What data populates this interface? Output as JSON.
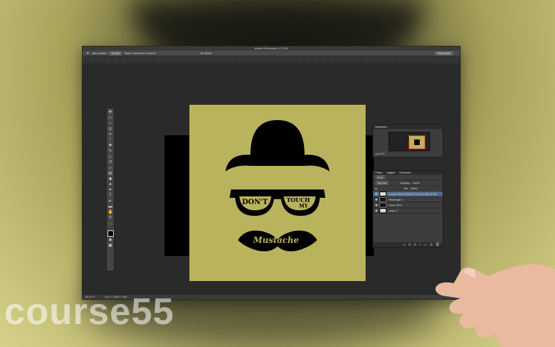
{
  "window": {
    "title": "Adobe Photoshop CC 2015",
    "options_bar": {
      "auto_select_label": "Auto-Select:",
      "auto_select_value": "Group",
      "transform_label": "Show Transform Controls",
      "mode_label": "3D Mode:",
      "workspace_value": "Essentials"
    },
    "status": {
      "zoom": "66.67%",
      "doc": "Doc: 2.06M/7.43M"
    }
  },
  "canvas": {
    "background_color": "#b9b35d",
    "artwork_text": {
      "left_lens": "DON'T",
      "right_lens_line1": "TOUCH",
      "right_lens_line2": "MY",
      "mustache": "Mustache"
    }
  },
  "navigator": {
    "title": "Navigator",
    "zoom": "66.67%"
  },
  "layers_panel": {
    "tabs": [
      "Paths",
      "Layers",
      "Channels"
    ],
    "filter": "Kind",
    "blend_mode": "Normal",
    "opacity_label": "Opacity:",
    "opacity_value": "100%",
    "fill_label": "Fill:",
    "fill_value": "100%",
    "layers": [
      {
        "name": "Screen Shot 2016-07-04 at 2.48.23 PM",
        "selected": true
      },
      {
        "name": "Rectangle 1",
        "selected": false
      },
      {
        "name": "Color Fill 3",
        "selected": false
      },
      {
        "name": "Layer 1",
        "selected": false
      }
    ]
  },
  "watermark": "course55"
}
